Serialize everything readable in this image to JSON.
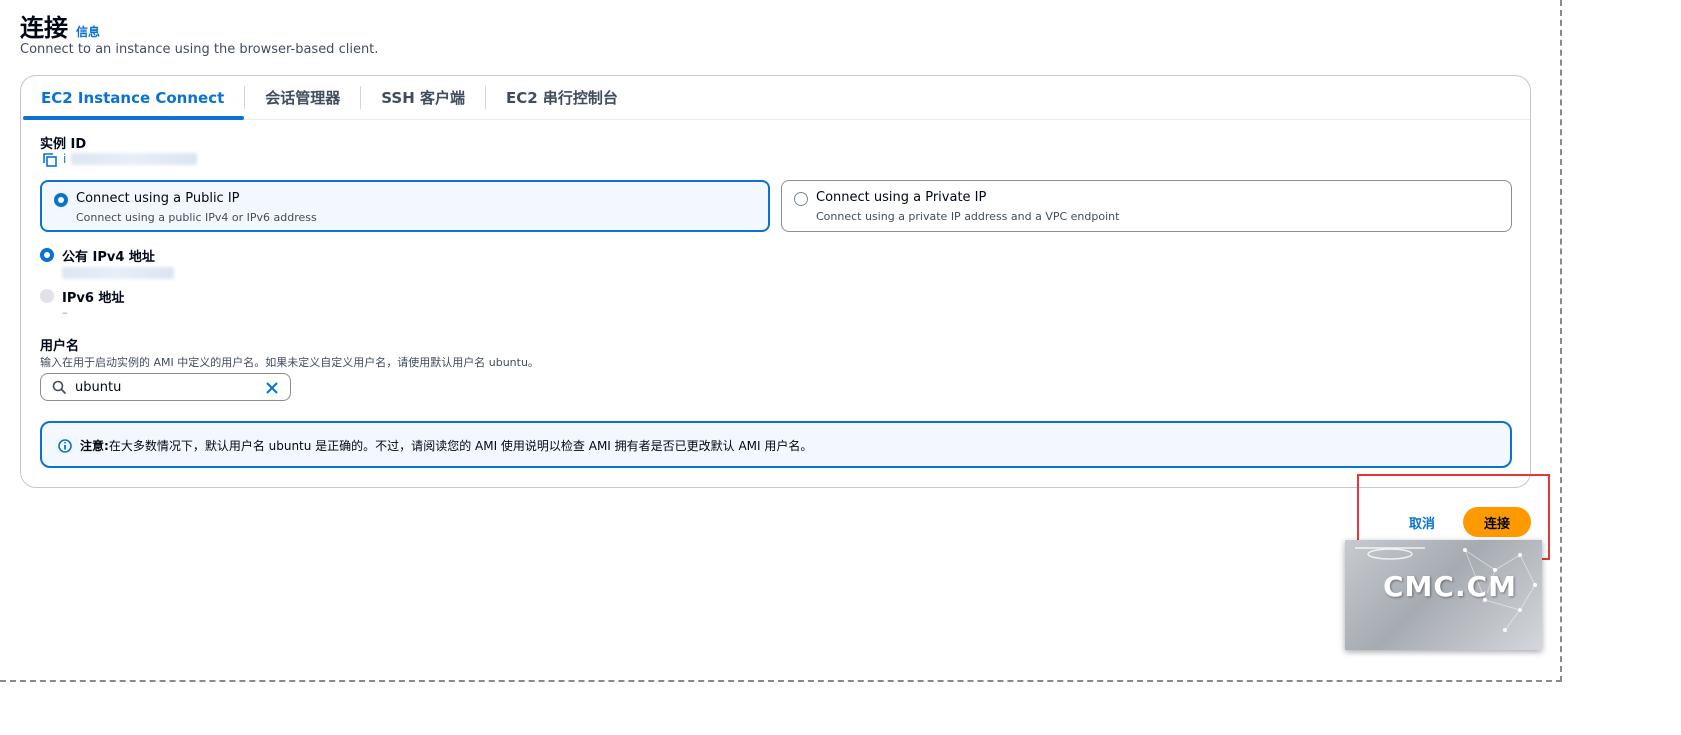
{
  "header": {
    "title": "连接",
    "info_link": "信息",
    "subtitle": "Connect to an instance using the browser-based client."
  },
  "tabs": [
    {
      "label": "EC2 Instance Connect",
      "active": true
    },
    {
      "label": "会话管理器",
      "active": false
    },
    {
      "label": "SSH 客户端",
      "active": false
    },
    {
      "label": "EC2 串行控制台",
      "active": false
    }
  ],
  "instance": {
    "label": "实例 ID",
    "value_prefix": "i"
  },
  "connection_type": {
    "public": {
      "title": "Connect using a Public IP",
      "description": "Connect using a public IPv4 or IPv6 address",
      "selected": true
    },
    "private": {
      "title": "Connect using a Private IP",
      "description": "Connect using a private IP address and a VPC endpoint",
      "selected": false
    }
  },
  "ip_options": {
    "ipv4": {
      "label": "公有 IPv4 地址",
      "selected": true
    },
    "ipv6": {
      "label": "IPv6 地址",
      "selected": false,
      "value": "–"
    }
  },
  "username": {
    "label": "用户名",
    "help": "输入在用于启动实例的 AMI 中定义的用户名。如果未定义自定义用户名，请使用默认用户名 ubuntu。",
    "value": "ubuntu"
  },
  "alert": {
    "prefix": "注意:",
    "text": "在大多数情况下，默认用户名 ubuntu 是正确的。不过，请阅读您的 AMI 使用说明以检查 AMI 拥有者是否已更改默认 AMI 用户名。"
  },
  "actions": {
    "cancel": "取消",
    "connect": "连接"
  },
  "watermark": {
    "text": "CMC.CM"
  },
  "colors": {
    "accent": "#0972d3",
    "primary_button": "#ff9900",
    "highlight": "#e53935"
  }
}
